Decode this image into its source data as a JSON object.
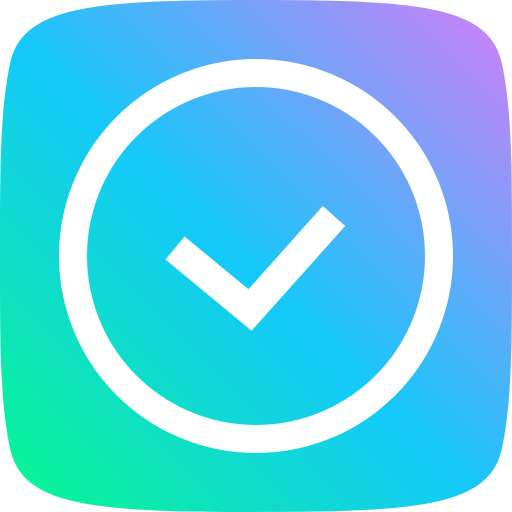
{
  "icon": {
    "name": "check-circle-icon",
    "gradient": {
      "top_right": "#d77cf7",
      "middle": "#14c8fa",
      "bottom_left": "#08f88c"
    },
    "glyph_color": "#ffffff"
  }
}
